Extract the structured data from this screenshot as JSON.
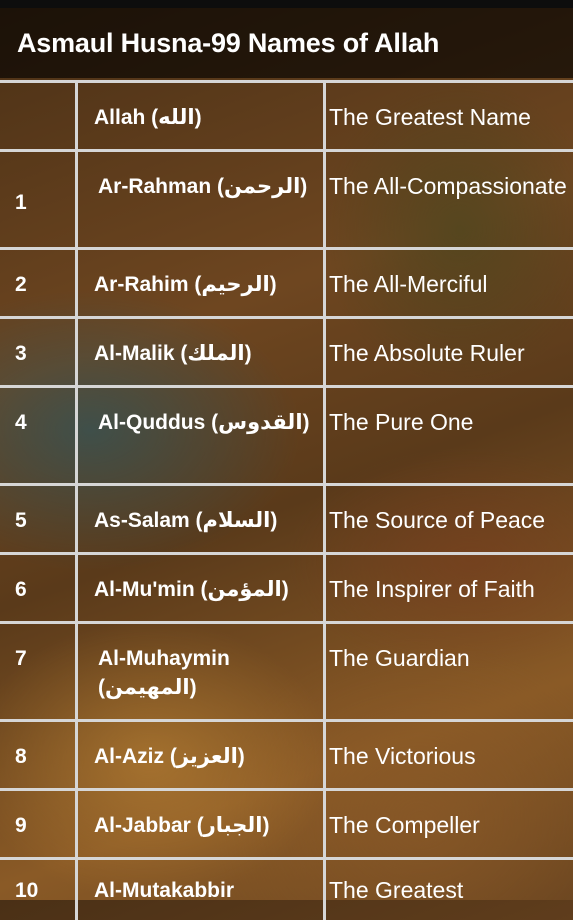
{
  "app": {
    "title": "Asmaul Husna-99 Names of Allah"
  },
  "names": [
    {
      "num": "",
      "name": "Allah (الله)",
      "meaning": "The Greatest Name"
    },
    {
      "num": "1",
      "name": "Ar-Rahman (الرحمن)",
      "meaning": "The All-Compassionate"
    },
    {
      "num": "2",
      "name": "Ar-Rahim (الرحيم)",
      "meaning": "The All-Merciful"
    },
    {
      "num": "3",
      "name": "Al-Malik (الملك)",
      "meaning": "The Absolute Ruler"
    },
    {
      "num": "4",
      "name": "Al-Quddus (القدوس)",
      "meaning": "The Pure One"
    },
    {
      "num": "5",
      "name": "As-Salam (السلام)",
      "meaning": "The Source of Peace"
    },
    {
      "num": "6",
      "name": "Al-Mu'min (المؤمن)",
      "meaning": "The Inspirer of Faith"
    },
    {
      "num": "7",
      "name": "Al-Muhaymin (المهيمن)",
      "meaning": "The Guardian"
    },
    {
      "num": "8",
      "name": "Al-Aziz (العزيز)",
      "meaning": "The Victorious"
    },
    {
      "num": "9",
      "name": "Al-Jabbar (الجبار)",
      "meaning": "The Compeller"
    },
    {
      "num": "10",
      "name": "Al-Mutakabbir",
      "meaning": "The Greatest"
    }
  ]
}
